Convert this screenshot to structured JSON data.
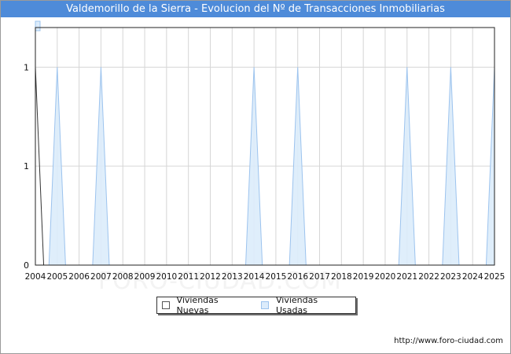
{
  "title": "Valdemorillo de la Sierra - Evolucion del Nº de Transacciones Inmobiliarias",
  "watermark": "FORO-CIUDAD.COM",
  "source": "http://www.foro-ciudad.com",
  "colors": {
    "title_bg": "#4e8bd9",
    "series_nuevas_fill": "#ffffff",
    "series_nuevas_line": "#333333",
    "series_usadas_fill": "#dcecfb",
    "series_usadas_line": "#9cc3ee",
    "grid": "#d6d6d6"
  },
  "legend": {
    "items": [
      {
        "label": "Viviendas Nuevas"
      },
      {
        "label": "Viviendas Usadas"
      }
    ]
  },
  "chart_data": {
    "type": "area",
    "title": "Valdemorillo de la Sierra - Evolucion del Nº de Transacciones Inmobiliarias",
    "xlabel": "",
    "ylabel": "",
    "grid": true,
    "legend_position": "bottom",
    "ylim": [
      0,
      1.2
    ],
    "yticks": [
      {
        "value": 0,
        "label": "0"
      },
      {
        "value": 0.5,
        "label": "1"
      },
      {
        "value": 1,
        "label": "1"
      }
    ],
    "x": [
      "2004",
      "2005",
      "2006",
      "2007",
      "2008",
      "2009",
      "2010",
      "2011",
      "2012",
      "2013",
      "2014",
      "2015",
      "2016",
      "2017",
      "2018",
      "2019",
      "2020",
      "2021",
      "2022",
      "2023",
      "2024",
      "2025"
    ],
    "series": [
      {
        "name": "Viviendas Nuevas",
        "values": [
          1,
          0,
          0,
          0,
          0,
          0,
          0,
          0,
          0,
          0,
          0,
          0,
          0,
          0,
          0,
          0,
          0,
          0,
          0,
          0,
          0,
          0
        ]
      },
      {
        "name": "Viviendas Usadas",
        "values": [
          0,
          1,
          0,
          1,
          0,
          0,
          0,
          0,
          0,
          0,
          1,
          0,
          1,
          0,
          0,
          0,
          0,
          1,
          0,
          1,
          0,
          1
        ]
      }
    ]
  }
}
